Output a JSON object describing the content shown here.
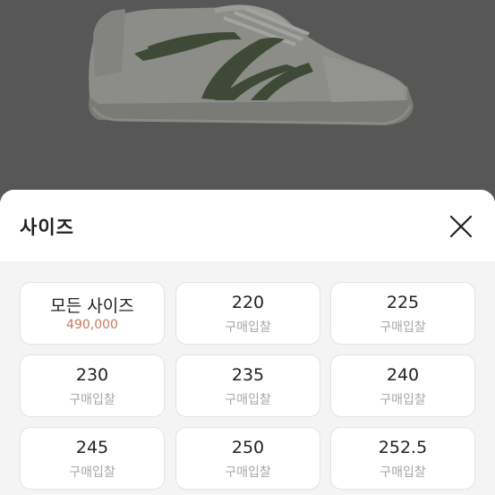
{
  "sheet": {
    "title": "사이즈",
    "close_icon": "close-icon",
    "sizes": [
      {
        "label": "모든 사이즈",
        "sub": "490,000",
        "sub_type": "price"
      },
      {
        "label": "220",
        "sub": "구매입찰"
      },
      {
        "label": "225",
        "sub": "구매입찰"
      },
      {
        "label": "230",
        "sub": "구매입찰"
      },
      {
        "label": "235",
        "sub": "구매입찰"
      },
      {
        "label": "240",
        "sub": "구매입찰"
      },
      {
        "label": "245",
        "sub": "구매입찰"
      },
      {
        "label": "250",
        "sub": "구매입찰"
      },
      {
        "label": "252.5",
        "sub": "구매입찰"
      }
    ]
  },
  "colors": {
    "price": "#c8795e",
    "muted": "#a8a8a8",
    "overlay": "#575757"
  }
}
